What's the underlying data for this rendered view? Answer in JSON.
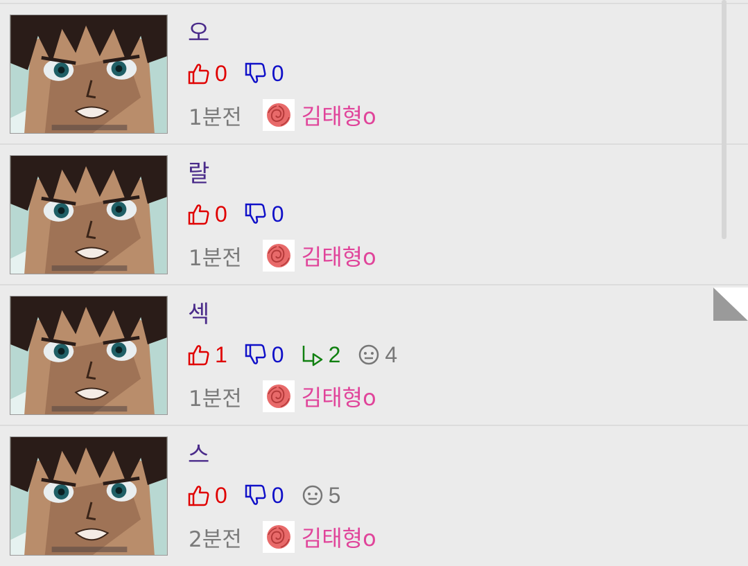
{
  "posts": [
    {
      "title": "오",
      "upvotes": "0",
      "downvotes": "0",
      "time": "1분전",
      "author": "김태형o"
    },
    {
      "title": "랄",
      "upvotes": "0",
      "downvotes": "0",
      "time": "1분전",
      "author": "김태형o"
    },
    {
      "title": "섹",
      "upvotes": "1",
      "downvotes": "0",
      "replies": "2",
      "comments": "4",
      "time": "1분전",
      "author": "김태형o"
    },
    {
      "title": "스",
      "upvotes": "0",
      "downvotes": "0",
      "comments": "5",
      "time": "2분전",
      "author": "김태형o"
    }
  ],
  "icons": {
    "upvote": "thumbs-up-icon",
    "downvote": "thumbs-down-icon",
    "reply": "reply-arrow-icon",
    "comment": "comment-face-icon",
    "avatar": "rose-icon"
  },
  "colors": {
    "background": "#ebebeb",
    "title": "#4a2b8a",
    "upvote": "#e00000",
    "downvote": "#1010c8",
    "reply": "#108010",
    "comment": "#777777",
    "time": "#7a7a7a",
    "author": "#e0449a"
  }
}
